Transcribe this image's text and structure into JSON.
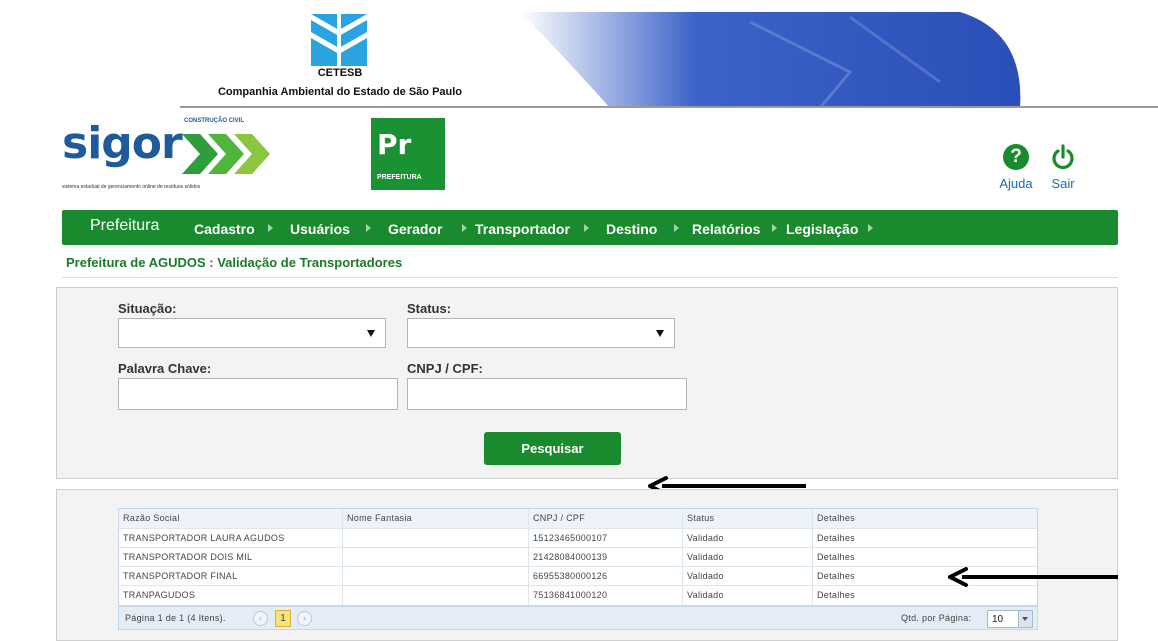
{
  "banner": {
    "org_short": "CETESB",
    "org_full": "Companhia Ambiental do Estado de São Paulo"
  },
  "brand": {
    "logo_word": "sigor",
    "logo_superscript": "CONSTRUÇÃO CIVIL",
    "tagline": "sistema estadual de gerenciamento online de resíduos sólidos"
  },
  "profile_badge": {
    "letters": "Pr",
    "label": "PREFEITURA"
  },
  "toolbar": {
    "help_label": "Ajuda",
    "help_glyph": "?",
    "exit_label": "Sair"
  },
  "nav": {
    "home": "Prefeitura",
    "items": [
      "Cadastro",
      "Usuários",
      "Gerador",
      "Transportador",
      "Destino",
      "Relatórios",
      "Legislação"
    ]
  },
  "page_title": "Prefeitura de AGUDOS : Validação de Transportadores",
  "filters": {
    "situacao_label": "Situação:",
    "situacao_value": "",
    "status_label": "Status:",
    "status_value": "",
    "keyword_label": "Palavra Chave:",
    "keyword_value": "",
    "cnpj_label": "CNPJ / CPF:",
    "cnpj_value": "",
    "search_button": "Pesquisar"
  },
  "results": {
    "columns": [
      "Razão Social",
      "Nome Fantasia",
      "CNPJ / CPF",
      "Status",
      "Detalhes"
    ],
    "rows": [
      [
        "TRANSPORTADOR LAURA AGUDOS",
        "",
        "15123465000107",
        "Validado",
        "Detalhes"
      ],
      [
        "TRANSPORTADOR DOIS MIL",
        "",
        "21428084000139",
        "Validado",
        "Detalhes"
      ],
      [
        "TRANSPORTADOR FINAL",
        "",
        "66955380000126",
        "Validado",
        "Detalhes"
      ],
      [
        "TRANPAGUDOS",
        "",
        "75136841000120",
        "Validado",
        "Detalhes"
      ]
    ],
    "pager_text": "Página 1 de 1 (4 Itens).",
    "current_page": "1",
    "per_page_label": "Qtd. por Página:",
    "per_page_value": "10"
  },
  "colors": {
    "brand_green": "#1a8a2e",
    "brand_blue": "#1e5a9c",
    "heading_green": "#1a7a2a",
    "pager_current": "#f8e27a"
  }
}
